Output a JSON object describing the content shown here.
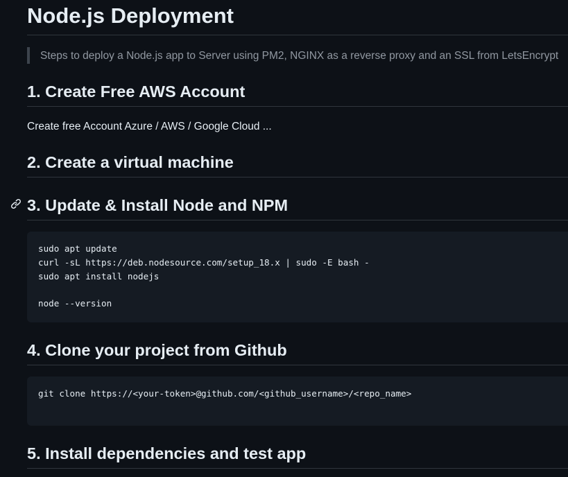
{
  "title": "Node.js Deployment",
  "description": "Steps to deploy a Node.js app to Server using PM2, NGINX as a reverse proxy and an SSL from LetsEncrypt",
  "sections": [
    {
      "heading": "1. Create Free AWS Account",
      "text": "Create free Account Azure / AWS / Google Cloud ..."
    },
    {
      "heading": "2. Create a virtual machine"
    },
    {
      "heading": "3. Update & Install Node and NPM",
      "code": [
        "sudo apt update",
        "curl -sL https://deb.nodesource.com/setup_18.x | sudo -E bash -",
        "sudo apt install nodejs",
        "",
        "node --version"
      ]
    },
    {
      "heading": "4. Clone your project from Github",
      "code": [
        "git clone https://<your-token>@github.com/<github_username>/<repo_name>"
      ]
    },
    {
      "heading": "5. Install dependencies and test app"
    }
  ],
  "icons": {
    "heading_anchor": "link-icon"
  },
  "colors": {
    "background": "#0d1117",
    "text": "#e6edf3",
    "muted_text": "#9198a1",
    "border": "#30363d",
    "code_background": "#151b23"
  }
}
